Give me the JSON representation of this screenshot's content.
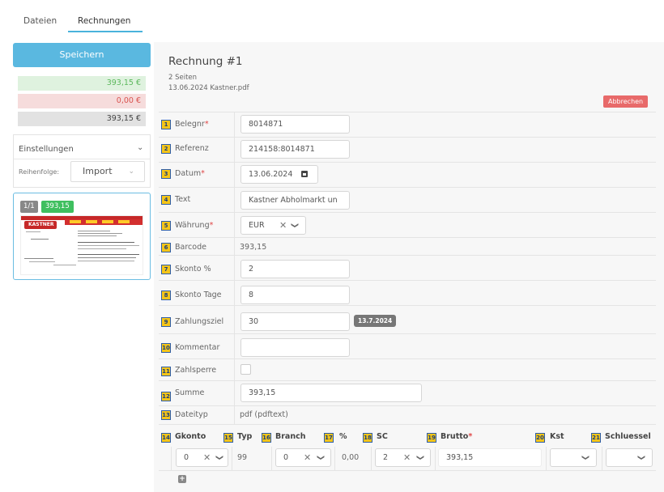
{
  "tabs": [
    {
      "label": "Dateien"
    },
    {
      "label": "Rechnungen"
    }
  ],
  "left": {
    "save_label": "Speichern",
    "sum_green": "393,15 €",
    "sum_red": "0,00 €",
    "sum_grey": "393,15 €",
    "settings_label": "Einstellungen",
    "order_label": "Reihenfolge:",
    "order_value": "Import",
    "thumb_page": "1/1",
    "thumb_amount": "393,15",
    "thumb_logo": "KASTNER"
  },
  "invoice": {
    "title": "Rechnung #1",
    "pages": "2 Seiten",
    "file": "13.06.2024 Kastner.pdf",
    "cancel_label": "Abbrechen"
  },
  "fields": {
    "belegnr": {
      "num": "1",
      "label": "Belegnr",
      "value": "8014871"
    },
    "referenz": {
      "num": "2",
      "label": "Referenz",
      "value": "214158:8014871"
    },
    "datum": {
      "num": "3",
      "label": "Datum",
      "value": "13.06.2024"
    },
    "text": {
      "num": "4",
      "label": "Text",
      "value": "Kastner Abholmarkt un"
    },
    "waehrung": {
      "num": "5",
      "label": "Währung",
      "value": "EUR"
    },
    "barcode": {
      "num": "6",
      "label": "Barcode",
      "value": "393,15"
    },
    "skonto_pct": {
      "num": "7",
      "label": "Skonto %",
      "value": "2"
    },
    "skonto_tage": {
      "num": "8",
      "label": "Skonto Tage",
      "value": "8"
    },
    "zahlungsziel": {
      "num": "9",
      "label": "Zahlungsziel",
      "value": "30",
      "badge": "13.7.2024"
    },
    "kommentar": {
      "num": "10",
      "label": "Kommentar",
      "value": ""
    },
    "zahlsperre": {
      "num": "11",
      "label": "Zahlsperre"
    },
    "summe": {
      "num": "12",
      "label": "Summe",
      "value": "393,15"
    },
    "dateityp": {
      "num": "13",
      "label": "Dateityp",
      "value": "pdf (pdftext)"
    }
  },
  "table": {
    "headers": [
      {
        "num": "14",
        "label": "Gkonto"
      },
      {
        "num": "15",
        "label": "Typ"
      },
      {
        "num": "16",
        "label": "Branch"
      },
      {
        "num": "17",
        "label": "%"
      },
      {
        "num": "18",
        "label": "SC"
      },
      {
        "num": "19",
        "label": "Brutto"
      },
      {
        "num": "20",
        "label": "Kst"
      },
      {
        "num": "21",
        "label": "Schluessel"
      }
    ],
    "row": {
      "gkonto": "0",
      "typ": "99",
      "branch": "0",
      "pct": "0,00",
      "sc": "2",
      "brutto": "393,15"
    },
    "add_label": "+"
  }
}
